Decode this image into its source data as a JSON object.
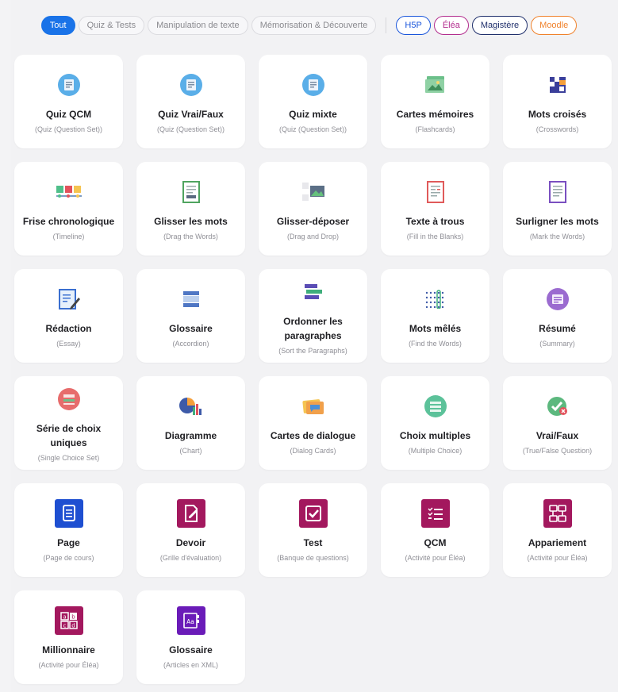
{
  "filters": {
    "tout": "Tout",
    "quiz_tests": "Quiz & Tests",
    "manipulation": "Manipulation de texte",
    "memorisation": "Mémorisation & Découverte",
    "h5p": "H5P",
    "elea": "Éléa",
    "magistere": "Magistère",
    "moodle": "Moodle"
  },
  "cards": [
    {
      "title": "Quiz QCM",
      "subtitle": "(Quiz (Question Set))"
    },
    {
      "title": "Quiz Vrai/Faux",
      "subtitle": "(Quiz (Question Set))"
    },
    {
      "title": "Quiz mixte",
      "subtitle": "(Quiz (Question Set))"
    },
    {
      "title": "Cartes mémoires",
      "subtitle": "(Flashcards)"
    },
    {
      "title": "Mots croisés",
      "subtitle": "(Crosswords)"
    },
    {
      "title": "Frise chronologique",
      "subtitle": "(Timeline)"
    },
    {
      "title": "Glisser les mots",
      "subtitle": "(Drag the Words)"
    },
    {
      "title": "Glisser-déposer",
      "subtitle": "(Drag and Drop)"
    },
    {
      "title": "Texte à trous",
      "subtitle": "(Fill in the Blanks)"
    },
    {
      "title": "Surligner les mots",
      "subtitle": "(Mark the Words)"
    },
    {
      "title": "Rédaction",
      "subtitle": "(Essay)"
    },
    {
      "title": "Glossaire",
      "subtitle": "(Accordion)"
    },
    {
      "title": "Ordonner les paragraphes",
      "subtitle": "(Sort the Paragraphs)"
    },
    {
      "title": "Mots mêlés",
      "subtitle": "(Find the Words)"
    },
    {
      "title": "Résumé",
      "subtitle": "(Summary)"
    },
    {
      "title": "Série de choix uniques",
      "subtitle": "(Single Choice Set)"
    },
    {
      "title": "Diagramme",
      "subtitle": "(Chart)"
    },
    {
      "title": "Cartes de dialogue",
      "subtitle": "(Dialog Cards)"
    },
    {
      "title": "Choix multiples",
      "subtitle": "(Multiple Choice)"
    },
    {
      "title": "Vrai/Faux",
      "subtitle": "(True/False Question)"
    },
    {
      "title": "Page",
      "subtitle": "(Page de cours)"
    },
    {
      "title": "Devoir",
      "subtitle": "(Grille d'évaluation)"
    },
    {
      "title": "Test",
      "subtitle": "(Banque de questions)"
    },
    {
      "title": "QCM",
      "subtitle": "(Activité pour Éléa)"
    },
    {
      "title": "Appariement",
      "subtitle": "(Activité pour Éléa)"
    },
    {
      "title": "Millionnaire",
      "subtitle": "(Activité pour Éléa)"
    },
    {
      "title": "Glossaire",
      "subtitle": "(Articles en XML)"
    }
  ],
  "colors": {
    "accent": "#1a73e8",
    "h5p": "#1a56db",
    "elea": "#b32d8e",
    "magistere": "#1f2f6b",
    "moodle": "#f0822c",
    "moodle_page": "#1e4fd1",
    "elea_icon": "#a3185e",
    "glossary_xml": "#6a1bb8"
  }
}
